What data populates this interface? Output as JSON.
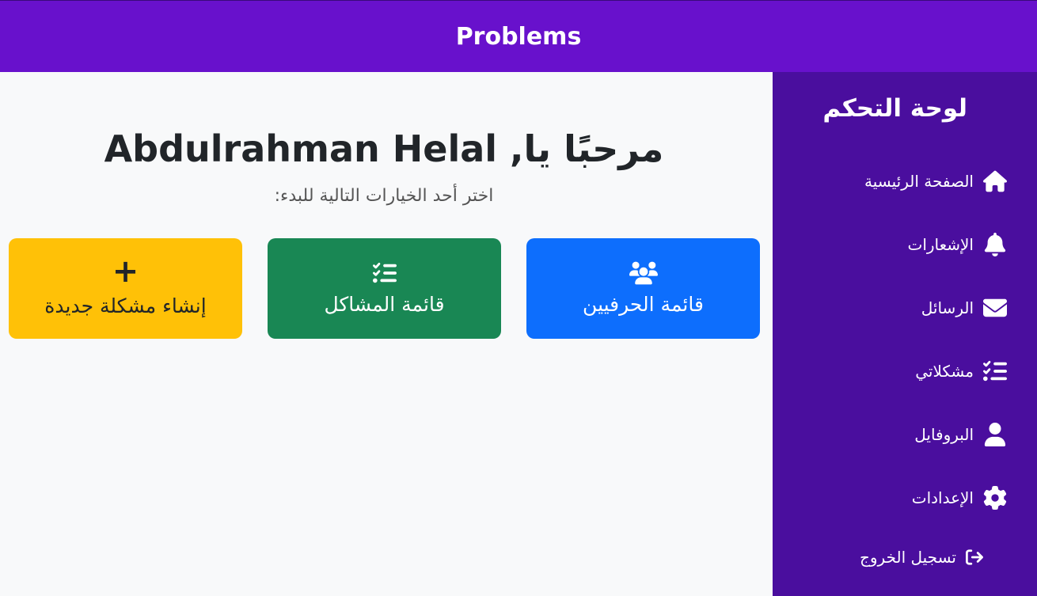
{
  "header": {
    "title": "Problems"
  },
  "sidebar": {
    "title": "لوحة التحكم",
    "items": [
      {
        "label": "الصفحة الرئيسية",
        "icon": "home-icon"
      },
      {
        "label": "الإشعارات",
        "icon": "bell-icon"
      },
      {
        "label": "الرسائل",
        "icon": "envelope-icon"
      },
      {
        "label": "مشكلاتي",
        "icon": "list-check-icon"
      },
      {
        "label": "البروفايل",
        "icon": "user-icon"
      },
      {
        "label": "الإعدادات",
        "icon": "gear-icon"
      },
      {
        "label": "تسجيل الخروج",
        "icon": "sign-out-icon"
      }
    ]
  },
  "main": {
    "welcome": "مرحبًا يا, Abdulrahman Helal",
    "subtitle": "اختر أحد الخيارات التالية للبدء:",
    "cards": [
      {
        "label": "قائمة الحرفيين",
        "icon": "users-icon",
        "color": "#0d6efd"
      },
      {
        "label": "قائمة المشاكل",
        "icon": "list-check-icon",
        "color": "#198754"
      },
      {
        "label": "إنشاء مشكلة جديدة",
        "icon": "plus-icon",
        "color": "#ffc107",
        "icon_glyph": "+"
      }
    ]
  },
  "colors": {
    "header": "#6811cc",
    "sidebar": "#4a0e9e",
    "background": "#f8f9fa"
  }
}
